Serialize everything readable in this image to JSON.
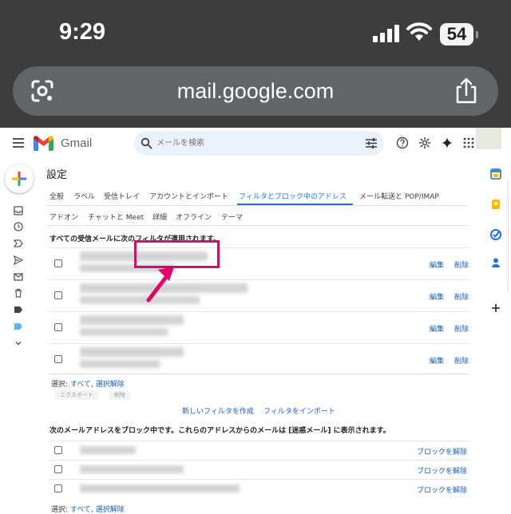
{
  "status_bar": {
    "time": "9:29",
    "battery": "54"
  },
  "browser": {
    "url": "mail.google.com"
  },
  "gmail_header": {
    "app_name": "Gmail",
    "search_placeholder": "メールを検索"
  },
  "settings": {
    "title": "設定",
    "tabs_row1": [
      "全般",
      "ラベル",
      "受信トレイ",
      "アカウントとインポート",
      "フィルタとブロック中のアドレス",
      "メール転送と POP/IMAP"
    ],
    "tabs_row2": [
      "アドオン",
      "チャットと Meet",
      "詳細",
      "オフライン",
      "テーマ"
    ],
    "active_tab": "フィルタとブロック中のアドレス",
    "filters_heading": "すべての受信メールに次のフィルタが適用されます。",
    "filter_rows": [
      {
        "edit": "編集",
        "delete": "削除"
      },
      {
        "edit": "編集",
        "delete": "削除"
      },
      {
        "edit": "編集",
        "delete": "削除"
      },
      {
        "edit": "編集",
        "delete": "削除"
      }
    ],
    "select_label": "選択:",
    "select_all": "すべて",
    "select_separator": ",",
    "select_none": "選択解除",
    "export_button": "エクスポート",
    "delete_button": "削除",
    "create_filter": "新しいフィルタを作成",
    "import_filters": "フィルタをインポート",
    "blocked_heading": "次のメールアドレスをブロック中です。これらのアドレスからのメールは [迷惑メール] に表示されます。",
    "blocked_rows": [
      {
        "unblock": "ブロックを解除"
      },
      {
        "unblock": "ブロックを解除"
      },
      {
        "unblock": "ブロックを解除"
      }
    ],
    "bottom_select_label": "選択:",
    "bottom_select_all": "すべて",
    "bottom_select_none": "選択解除"
  },
  "colors": {
    "accent": "#1a73e8",
    "link": "#1a5fb4",
    "highlight": "#e6006e",
    "browser_chrome": "#3b3d3f"
  }
}
